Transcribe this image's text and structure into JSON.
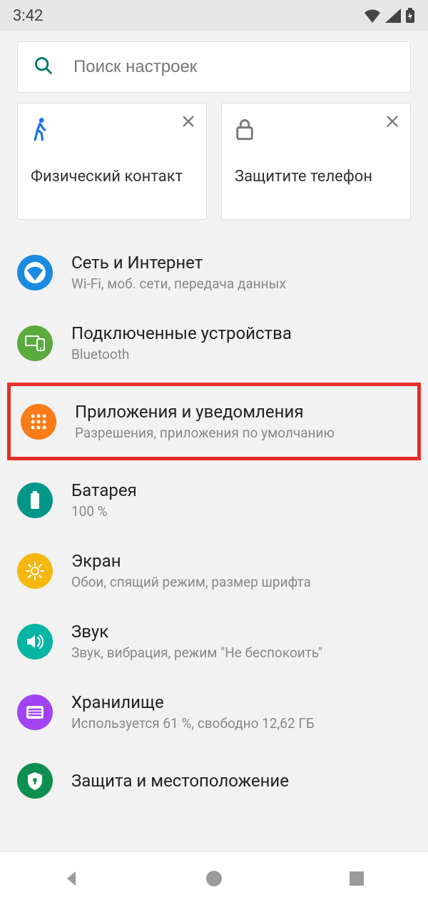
{
  "status": {
    "time": "3:42"
  },
  "search": {
    "placeholder": "Поиск настроек"
  },
  "cards": [
    {
      "title": "Физический контакт",
      "icon": "walk-icon"
    },
    {
      "title": "Защитите телефон",
      "icon": "lock-icon"
    }
  ],
  "items": [
    {
      "title": "Сеть и Интернет",
      "sub": "Wi-Fi, моб. сети, передача данных",
      "icon": "wifi-icon",
      "bg": "bg-blue",
      "highlight": false
    },
    {
      "title": "Подключенные устройства",
      "sub": "Bluetooth",
      "icon": "devices-icon",
      "bg": "bg-green",
      "highlight": false
    },
    {
      "title": "Приложения и уведомления",
      "sub": "Разрешения, приложения по умолчанию",
      "icon": "apps-icon",
      "bg": "bg-orange",
      "highlight": true
    },
    {
      "title": "Батарея",
      "sub": "100 %",
      "icon": "battery-icon",
      "bg": "bg-teal",
      "highlight": false
    },
    {
      "title": "Экран",
      "sub": "Обои, спящий режим, размер шрифта",
      "icon": "brightness-icon",
      "bg": "bg-yellow",
      "highlight": false
    },
    {
      "title": "Звук",
      "sub": "Звук, вибрация, режим \"Не беспокоить\"",
      "icon": "sound-icon",
      "bg": "bg-cyan",
      "highlight": false
    },
    {
      "title": "Хранилище",
      "sub": "Используется 61 %, свободно 12,62 ГБ",
      "icon": "storage-icon",
      "bg": "bg-purple",
      "highlight": false
    },
    {
      "title": "Защита и местоположение",
      "sub": "",
      "icon": "security-icon",
      "bg": "bg-green2",
      "highlight": false
    }
  ],
  "colors": {
    "highlight_border": "#e53027"
  }
}
